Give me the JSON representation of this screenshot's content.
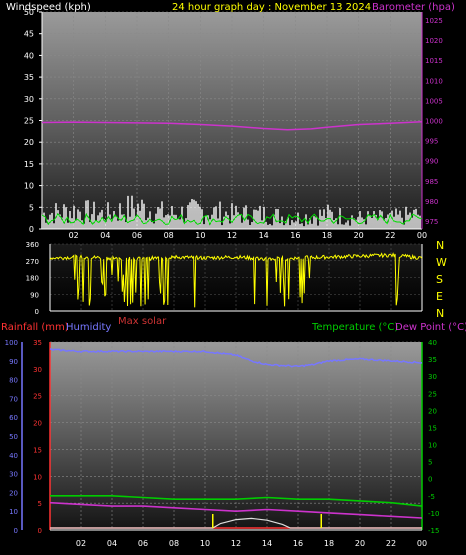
{
  "colors": {
    "wind": "#ffffff",
    "gust": "#00dd00",
    "barometer": "#cc33cc",
    "direction": "#ffff00",
    "rain": "#ff3333",
    "humidity": "#7777ff",
    "temperature": "#00cc00",
    "dewpoint": "#cc33cc",
    "solar": "#ffff00",
    "solar_label": "#cc3333",
    "title": "#ffff00",
    "tick": "#ffffff"
  },
  "header": {
    "windspeed": "Windspeed (kph)",
    "title": "24 hour graph day : November 13 2024",
    "barometer": "Barometer (hpa)"
  },
  "mid_labels": {
    "rainfall": "Rainfall (mm)",
    "humidity": "Humidity",
    "max_solar": "Max solar",
    "temperature": "Temperature (°C)",
    "dewpoint": "Dew Point (°C)"
  },
  "compass": [
    "N",
    "W",
    "S",
    "E",
    "N"
  ],
  "x_ticks": [
    "02",
    "04",
    "06",
    "08",
    "10",
    "12",
    "14",
    "16",
    "18",
    "20",
    "22",
    "00"
  ],
  "chart_data": [
    {
      "type": "line",
      "name": "wind-barometer",
      "x_ticks": [
        "02",
        "04",
        "06",
        "08",
        "10",
        "12",
        "14",
        "16",
        "18",
        "20",
        "22",
        "00"
      ],
      "y_left_ticks": [
        0,
        5,
        10,
        15,
        20,
        25,
        30,
        35,
        40,
        45,
        50
      ],
      "y_left_range": [
        0,
        50
      ],
      "y_right_ticks": [
        975,
        980,
        985,
        990,
        995,
        1000,
        1005,
        1010,
        1015,
        1020,
        1025
      ],
      "y_right_range": [
        973,
        1027
      ],
      "series": [
        {
          "name": "Windspeed (kph)",
          "x": [
            0,
            2,
            4,
            6,
            8,
            10,
            12,
            14,
            16,
            18,
            20,
            22,
            24
          ],
          "values": [
            4,
            5,
            4,
            6,
            4,
            5,
            4,
            4,
            3,
            4,
            3,
            3,
            4
          ]
        },
        {
          "name": "Barometer (hpa)",
          "x": [
            0,
            2,
            4,
            6,
            8,
            10,
            12,
            14,
            15.5,
            17,
            18,
            20,
            22,
            24
          ],
          "values": [
            999.5,
            999.6,
            999.5,
            999.4,
            999.3,
            999.0,
            998.6,
            998.0,
            997.7,
            997.9,
            998.3,
            999.0,
            999.3,
            999.7
          ]
        }
      ]
    },
    {
      "type": "line",
      "name": "wind-direction",
      "y_ticks": [
        0,
        90,
        180,
        270,
        360
      ],
      "y_range": [
        0,
        360
      ],
      "series": [
        {
          "name": "Wind direction",
          "x": [
            0,
            2,
            4,
            6,
            8,
            10,
            12,
            14,
            16,
            18,
            20,
            22,
            24
          ],
          "values": [
            285,
            290,
            285,
            280,
            290,
            285,
            290,
            280,
            285,
            290,
            295,
            300,
            285
          ]
        }
      ]
    },
    {
      "type": "line",
      "name": "rain-humidity-temperature",
      "y_left_ticks": [
        0,
        10,
        20,
        30,
        40,
        50,
        60,
        70,
        80,
        90,
        100
      ],
      "y_left_range": [
        0,
        100
      ],
      "y_rain_ticks": [
        0,
        5,
        10,
        15,
        20,
        25,
        30,
        35
      ],
      "y_right_ticks": [
        -15,
        -10,
        -5,
        0,
        5,
        10,
        15,
        20,
        25,
        30,
        35,
        40
      ],
      "y_right_range": [
        -15,
        40
      ],
      "series": [
        {
          "name": "Humidity",
          "x": [
            0,
            2,
            4,
            6,
            8,
            10,
            12,
            13,
            14,
            16,
            17,
            18,
            20,
            22,
            24
          ],
          "values": [
            96,
            95,
            95,
            95,
            95,
            95,
            93,
            90,
            88,
            87,
            88,
            90,
            91,
            90,
            89
          ]
        },
        {
          "name": "Temperature (°C)",
          "x": [
            0,
            2,
            4,
            6,
            8,
            10,
            12,
            14,
            16,
            18,
            20,
            22,
            24
          ],
          "values": [
            -5,
            -5,
            -5,
            -5.5,
            -6,
            -6,
            -6,
            -5.5,
            -6,
            -6,
            -6.5,
            -7,
            -8
          ]
        },
        {
          "name": "Dew Point (°C)",
          "x": [
            0,
            2,
            4,
            6,
            8,
            10,
            12,
            14,
            16,
            18,
            20,
            22,
            24
          ],
          "values": [
            -7,
            -7.5,
            -8,
            -8,
            -8.5,
            -9,
            -9.5,
            -9,
            -9.5,
            -10,
            -10.5,
            -11,
            -11.5
          ]
        },
        {
          "name": "Rainfall (mm)",
          "x": [
            0,
            24
          ],
          "values": [
            0,
            0
          ]
        },
        {
          "name": "Max solar",
          "x": [
            0,
            10.5,
            11,
            12,
            13,
            14,
            15,
            15.5,
            24
          ],
          "values": [
            0,
            0,
            1.5,
            2.8,
            3.2,
            2.6,
            1.2,
            0,
            0
          ]
        }
      ]
    }
  ]
}
